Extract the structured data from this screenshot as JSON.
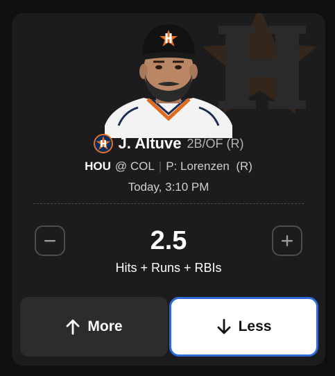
{
  "player": {
    "name": "J. Altuve",
    "position": "2B/OF (R)"
  },
  "matchup": {
    "team": "HOU",
    "opponent": "@ COL",
    "separator": "|",
    "pitcher": "P: Lorenzen  (R)"
  },
  "game_time": "Today, 3:10 PM",
  "projection": {
    "line": "2.5",
    "stat": "Hits + Runs + RBIs"
  },
  "buttons": {
    "more_label": "More",
    "less_label": "Less",
    "selected": "Less"
  },
  "icons": {
    "team_logo": "astros-logo-icon",
    "decrement": "minus-icon",
    "increment": "plus-icon",
    "more": "arrow-up-icon",
    "less": "arrow-down-icon"
  },
  "colors": {
    "card_bg": "#1c1c1e",
    "team_orange": "#eb6e1f",
    "team_navy": "#002d62",
    "selected_border": "#2f6bd8"
  }
}
